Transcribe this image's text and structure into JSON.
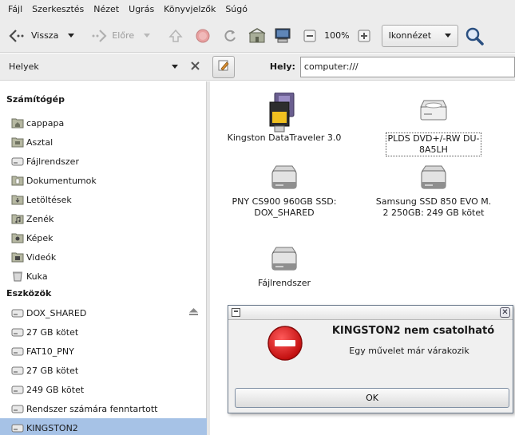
{
  "menubar": [
    "Fájl",
    "Szerkesztés",
    "Nézet",
    "Ugrás",
    "Könyvjelzők",
    "Súgó"
  ],
  "toolbar": {
    "back_label": "Vissza",
    "forward_label": "Előre",
    "zoom_level": "100%",
    "view_mode": "Ikonnézet"
  },
  "sidebar": {
    "header": "Helyek",
    "section_computer": "Számítógép",
    "computer_items": [
      "cappapa",
      "Asztal",
      "Fájlrendszer",
      "Dokumentumok",
      "Letöltések",
      "Zenék",
      "Képek",
      "Videók",
      "Kuka"
    ],
    "section_devices": "Eszközök",
    "device_items": [
      "DOX_SHARED",
      "27 GB kötet",
      "FAT10_PNY",
      "27 GB kötet",
      "249 GB kötet",
      "Rendszer számára fenntartott",
      "KINGSTON2"
    ]
  },
  "location": {
    "label": "Hely:",
    "value": "computer:///"
  },
  "items": [
    {
      "name": "Kingston DataTraveler 3.0",
      "lines": [
        "Kingston DataTraveler 3.0"
      ],
      "icon": "usb-drive-icon"
    },
    {
      "name": "PLDS DVD+/-RW DU-8A5LH",
      "lines": [
        "PLDS DVD+/-RW DU-",
        "8A5LH"
      ],
      "icon": "optical-drive-icon"
    },
    {
      "name": "PNY CS900 960GB SSD: DOX_SHARED",
      "lines": [
        "PNY CS900 960GB SSD:",
        "DOX_SHARED"
      ],
      "icon": "hard-drive-icon"
    },
    {
      "name": "Samsung SSD 850 EVO M.2 250GB: 249 GB kötet",
      "lines": [
        "Samsung SSD 850 EVO M.",
        "2 250GB: 249 GB kötet"
      ],
      "icon": "hard-drive-icon"
    },
    {
      "name": "Fájlrendszer",
      "lines": [
        "Fájlrendszer"
      ],
      "icon": "hard-drive-icon"
    }
  ],
  "dialog": {
    "heading": "KINGSTON2 nem csatolható",
    "message": "Egy művelet már várakozik",
    "ok_label": "OK",
    "icon": "error-icon"
  },
  "colors": {
    "selection": "#a6c2e6",
    "error_red": "#d01515",
    "chrome_bg": "#ececec"
  }
}
